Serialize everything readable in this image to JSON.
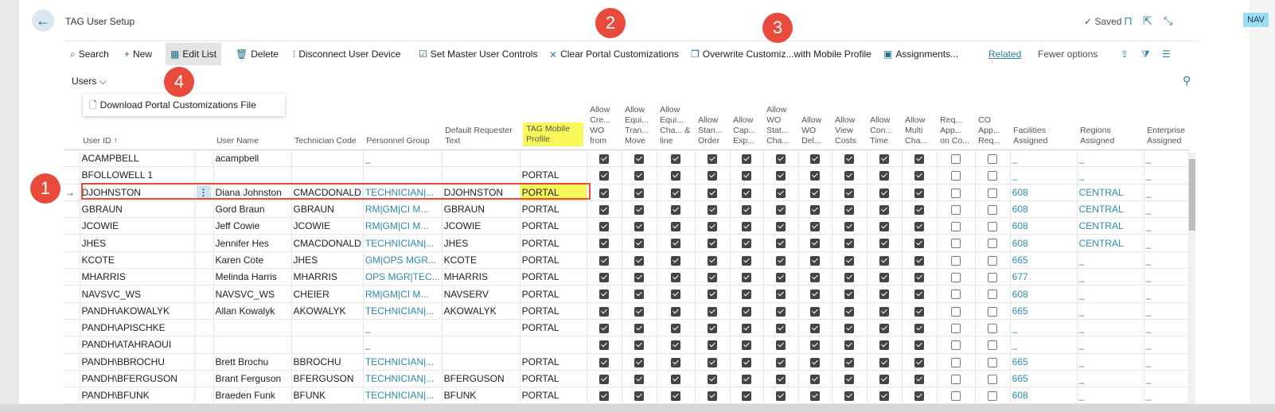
{
  "header": {
    "title": "TAG User Setup",
    "saved": "Saved",
    "nav": "NAV"
  },
  "toolbar": {
    "search": "Search",
    "new": "New",
    "edit_list": "Edit List",
    "delete": "Delete",
    "disconnect": "Disconnect User Device",
    "set_master": "Set Master User Controls",
    "clear_portal": "Clear Portal Customizations",
    "overwrite": "Overwrite Customiz...with Mobile Profile",
    "assignments": "Assignments...",
    "related": "Related",
    "fewer": "Fewer options"
  },
  "users_menu": {
    "label": "Users",
    "download": "Download Portal Customizations File"
  },
  "callouts": [
    "1",
    "2",
    "3",
    "4"
  ],
  "columns": [
    "User ID ↑",
    "User Name",
    "Technician Code",
    "Personnel Group",
    "Default Requester Text",
    "TAG Mobile Profile",
    "Allow Cre... WO from",
    "Allow Equi... Tran... Move",
    "Allow Equi... Cha... & line",
    "Allow Stan... Order",
    "Allow Cap... Exp...",
    "Allow WO Stat... Cha...",
    "Allow WO Del...",
    "Allow View Costs",
    "Allow Con... Time",
    "Allow Multi Cha...",
    "Req... App... on Co...",
    "CO App... Req...",
    "Facilities Assigned",
    "Regions Assigned",
    "Enterprise Assigned"
  ],
  "rows": [
    {
      "id": "ACAMPBELL",
      "name": "acampbell",
      "tech": "",
      "group": "_",
      "req": "",
      "profile": "",
      "fac": "_",
      "reg": "_",
      "ent": "_"
    },
    {
      "id": "BFOLLOWELL 1",
      "name": "",
      "tech": "",
      "group": "",
      "req": "",
      "profile": "PORTAL",
      "fac": "_",
      "reg": "_",
      "ent": "_"
    },
    {
      "id": "DJOHNSTON",
      "name": "Diana Johnston",
      "tech": "CMACDONALD",
      "group": "TECHNICIAN|...",
      "req": "DJOHNSTON",
      "profile": "PORTAL",
      "fac": "608",
      "reg": "CENTRAL",
      "ent": "_"
    },
    {
      "id": "GBRAUN",
      "name": "Gord Braun",
      "tech": "GBRAUN",
      "group": "RM|GM|CI M...",
      "req": "GBRAUN",
      "profile": "PORTAL",
      "fac": "608",
      "reg": "CENTRAL",
      "ent": "_"
    },
    {
      "id": "JCOWIE",
      "name": "Jeff Cowie",
      "tech": "JCOWIE",
      "group": "RM|GM|CI M...",
      "req": "JCOWIE",
      "profile": "PORTAL",
      "fac": "608",
      "reg": "CENTRAL",
      "ent": "_"
    },
    {
      "id": "JHES",
      "name": "Jennifer Hes",
      "tech": "CMACDONALD",
      "group": "TECHNICIAN|...",
      "req": "JHES",
      "profile": "PORTAL",
      "fac": "608",
      "reg": "CENTRAL",
      "ent": "_"
    },
    {
      "id": "KCOTE",
      "name": "Karen Cote",
      "tech": "JHES",
      "group": "GM|OPS MGR...",
      "req": "KCOTE",
      "profile": "PORTAL",
      "fac": "665",
      "reg": "_",
      "ent": "_"
    },
    {
      "id": "MHARRIS",
      "name": "Melinda Harris",
      "tech": "MHARRIS",
      "group": "OPS MGR|TEC...",
      "req": "MHARRIS",
      "profile": "PORTAL",
      "fac": "677",
      "reg": "_",
      "ent": "_"
    },
    {
      "id": "NAVSVC_WS",
      "name": "NAVSVC_WS",
      "tech": "CHEIER",
      "group": "RM|GM|CI M...",
      "req": "NAVSERV",
      "profile": "PORTAL",
      "fac": "608",
      "reg": "_",
      "ent": "_"
    },
    {
      "id": "PANDH\\AKOWALYK",
      "name": "Allan Kowalyk",
      "tech": "AKOWALYK",
      "group": "TECHNICIAN|...",
      "req": "AKOWALYK",
      "profile": "PORTAL",
      "fac": "665",
      "reg": "_",
      "ent": "_"
    },
    {
      "id": "PANDH\\APISCHKE",
      "name": "",
      "tech": "",
      "group": "_",
      "req": "",
      "profile": "PORTAL",
      "fac": "_",
      "reg": "_",
      "ent": "_"
    },
    {
      "id": "PANDH\\ATAHRAOUI",
      "name": "",
      "tech": "",
      "group": "_",
      "req": "",
      "profile": "",
      "fac": "_",
      "reg": "_",
      "ent": "_"
    },
    {
      "id": "PANDH\\BBROCHU",
      "name": "Brett Brochu",
      "tech": "BBROCHU",
      "group": "TECHNICIAN|...",
      "req": "",
      "profile": "PORTAL",
      "fac": "665",
      "reg": "_",
      "ent": "_"
    },
    {
      "id": "PANDH\\BFERGUSON",
      "name": "Brant Ferguson",
      "tech": "BFERGUSON",
      "group": "TECHNICIAN|...",
      "req": "BFERGUSON",
      "profile": "PORTAL",
      "fac": "665",
      "reg": "_",
      "ent": "_"
    },
    {
      "id": "PANDH\\BFUNK",
      "name": "Braeden Funk",
      "tech": "BFUNK",
      "group": "TECHNICIAN|...",
      "req": "BFUNK",
      "profile": "PORTAL",
      "fac": "608",
      "reg": "_",
      "ent": "_"
    }
  ]
}
